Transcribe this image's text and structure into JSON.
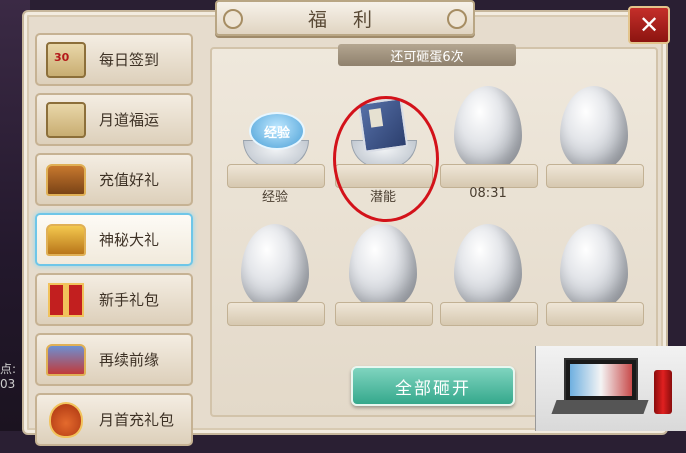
{
  "window": {
    "title": "福 利",
    "close_label": "✕"
  },
  "sidebar": {
    "items": [
      {
        "label": "每日签到",
        "icon": "calendar-scroll-icon",
        "badge": "30"
      },
      {
        "label": "月道福运",
        "icon": "yin-yang-scroll-icon"
      },
      {
        "label": "充值好礼",
        "icon": "treasure-chest-icon"
      },
      {
        "label": "神秘大礼",
        "icon": "golden-chest-icon",
        "active": true
      },
      {
        "label": "新手礼包",
        "icon": "gift-box-icon"
      },
      {
        "label": "再续前缘",
        "icon": "gift-basket-icon"
      },
      {
        "label": "月首充礼包",
        "icon": "lucky-bag-icon"
      }
    ]
  },
  "main": {
    "remaining_text": "还可砸蛋6次",
    "slots": [
      {
        "type": "reward",
        "icon": "exp-icon",
        "icon_text": "经验",
        "label": "经验"
      },
      {
        "type": "reward",
        "icon": "book-icon",
        "label": "潜能",
        "highlighted": true
      },
      {
        "type": "egg",
        "label": "08:31"
      },
      {
        "type": "egg",
        "label": ""
      },
      {
        "type": "egg",
        "label": ""
      },
      {
        "type": "egg",
        "label": ""
      },
      {
        "type": "egg",
        "label": ""
      },
      {
        "type": "egg",
        "label": ""
      }
    ],
    "open_all_label": "全部砸开"
  },
  "chat": {
    "snippet": "点: 03"
  },
  "colors": {
    "accent_teal": "#35a88c",
    "active_border": "#6ec6e8",
    "close_red": "#c42f2a",
    "highlight_circle": "#d3121a"
  }
}
